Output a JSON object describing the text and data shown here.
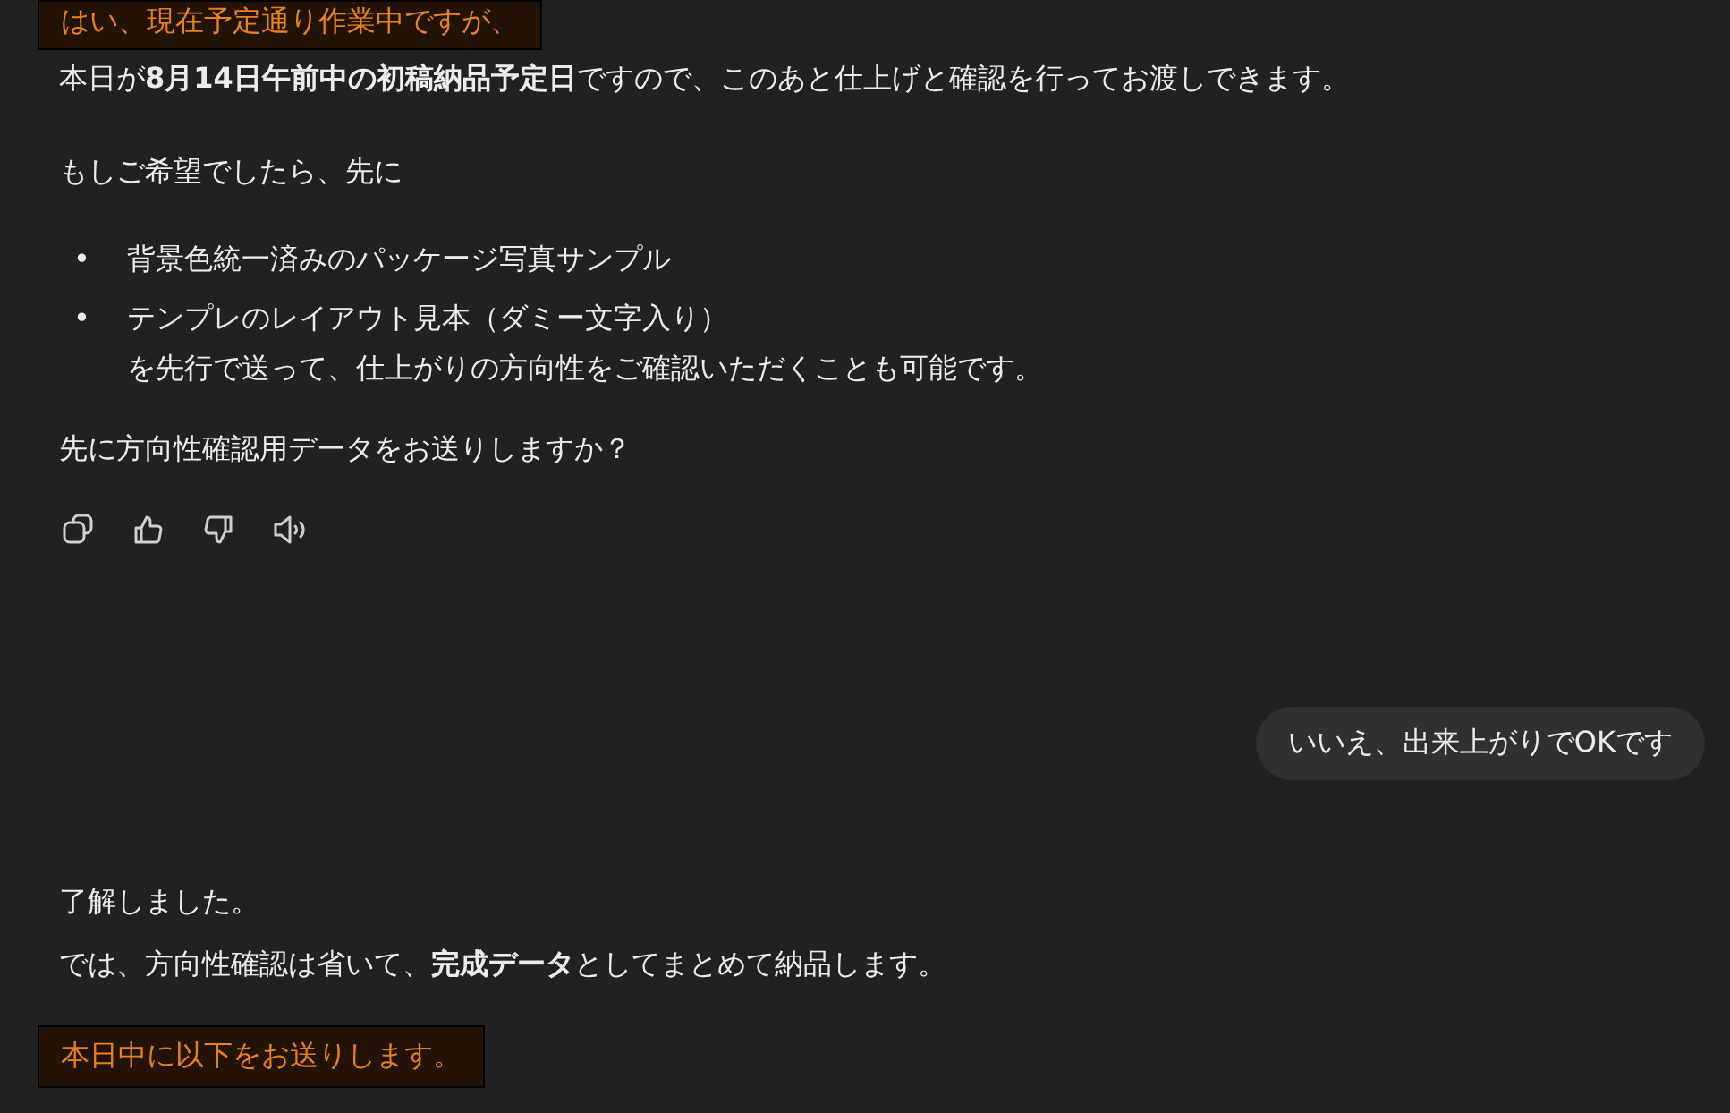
{
  "assistant_message": {
    "highlight": "はい、現在予定通り作業中ですが、",
    "paragraphs": [
      "本日が**8月14日午前中の初稿納品予定日**ですので、このあと仕上げと確認を行ってお渡しできます。",
      "もしご希望でしたら、先に"
    ],
    "bullets": [
      {
        "marker": "•",
        "text": "背景色統一済みのパッケージ写真サンプル"
      },
      {
        "marker": "•",
        "text": "テンプレのレイアウト見本（ダミー文字入り）"
      }
    ],
    "bullet_continuation": "を先行で送って、仕上がりの方向性をご確認いただくことも可能です。",
    "question": "先に方向性確認用データをお送りしますか？",
    "actions": [
      {
        "kind": "copy"
      },
      {
        "kind": "like"
      },
      {
        "kind": "dislike"
      },
      {
        "kind": "speak"
      }
    ]
  },
  "user_message": "いいえ、出来上がりでOKです",
  "reply": {
    "lines": [
      "了解しました。",
      "では、方向性確認は省いて、**完成データ**としてまとめて納品します。"
    ],
    "highlight": "本日中に以下をお送りします。"
  }
}
